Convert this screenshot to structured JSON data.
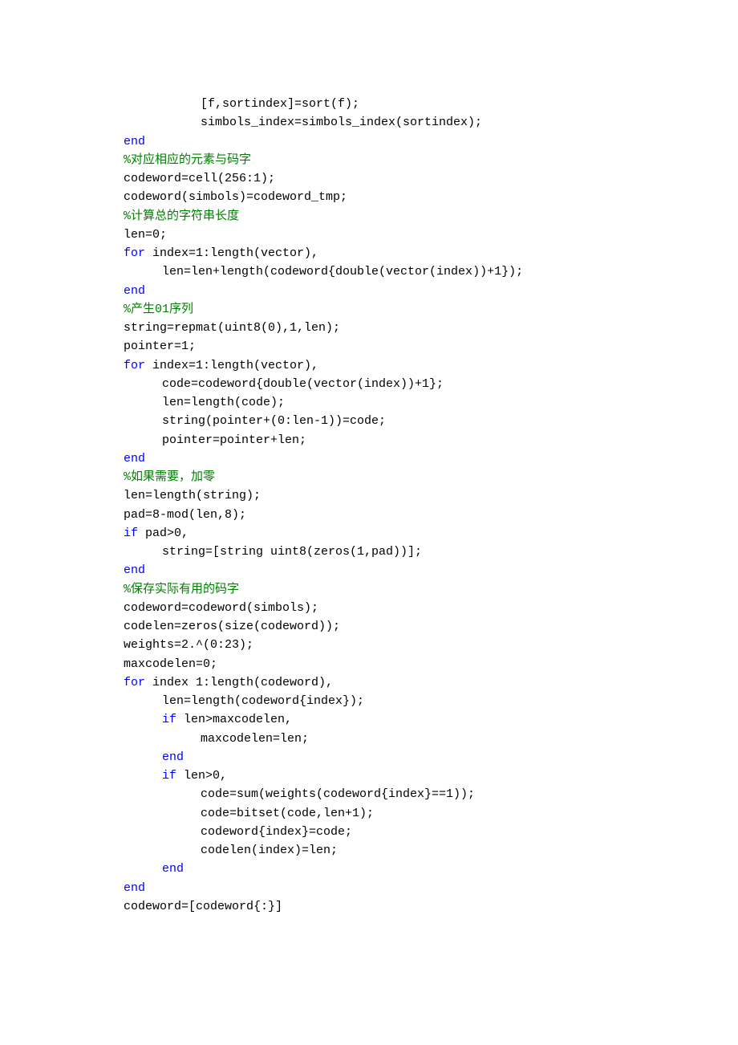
{
  "lines": [
    {
      "ind": 2,
      "txt": "[f,sortindex]=sort(f);"
    },
    {
      "ind": 2,
      "txt": "simbols_index=simbols_index(sortindex);"
    },
    {
      "ind": 0,
      "kw": "end"
    },
    {
      "ind": 0,
      "cm": "%对应相应的元素与码字"
    },
    {
      "ind": 0,
      "txt": "codeword=cell(256:1);"
    },
    {
      "ind": 0,
      "txt": "codeword(simbols)=codeword_tmp;"
    },
    {
      "ind": 0,
      "cm": "%计算总的字符串长度"
    },
    {
      "ind": 0,
      "txt": "len=0;"
    },
    {
      "ind": 0,
      "kw": "for",
      "txt": " index=1:length(vector),"
    },
    {
      "ind": 1,
      "txt": "len=len+length(codeword{double(vector(index))+1});"
    },
    {
      "ind": 0,
      "kw": "end"
    },
    {
      "ind": 0,
      "cm": "%产生01序列"
    },
    {
      "ind": 0,
      "txt": "string=repmat(uint8(0),1,len);"
    },
    {
      "ind": 0,
      "txt": "pointer=1;"
    },
    {
      "ind": 0,
      "kw": "for",
      "txt": " index=1:length(vector),"
    },
    {
      "ind": 1,
      "txt": "code=codeword{double(vector(index))+1};"
    },
    {
      "ind": 1,
      "txt": "len=length(code);"
    },
    {
      "ind": 1,
      "txt": "string(pointer+(0:len-1))=code;"
    },
    {
      "ind": 1,
      "txt": "pointer=pointer+len;"
    },
    {
      "ind": 0,
      "kw": "end"
    },
    {
      "ind": 0,
      "cm": "%如果需要，加零"
    },
    {
      "ind": 0,
      "txt": "len=length(string);"
    },
    {
      "ind": 0,
      "txt": "pad=8-mod(len,8);"
    },
    {
      "ind": 0,
      "kw": "if",
      "txt": " pad>0,"
    },
    {
      "ind": 1,
      "txt": "string=[string uint8(zeros(1,pad))];"
    },
    {
      "ind": 0,
      "kw": "end"
    },
    {
      "ind": 0,
      "cm": "%保存实际有用的码字"
    },
    {
      "ind": 0,
      "txt": "codeword=codeword(simbols);"
    },
    {
      "ind": 0,
      "txt": "codelen=zeros(size(codeword));"
    },
    {
      "ind": 0,
      "txt": "weights=2.^(0:23);"
    },
    {
      "ind": 0,
      "txt": "maxcodelen=0;"
    },
    {
      "ind": 0,
      "kw": "for",
      "txt": " index 1:length(codeword),"
    },
    {
      "ind": 1,
      "txt": "len=length(codeword{index});"
    },
    {
      "ind": 1,
      "kw": "if",
      "txt": " len>maxcodelen,"
    },
    {
      "ind": 2,
      "txt": "maxcodelen=len;"
    },
    {
      "ind": 1,
      "kw": "end"
    },
    {
      "ind": 1,
      "kw": "if",
      "txt": " len>0,"
    },
    {
      "ind": 2,
      "txt": "code=sum(weights(codeword{index}==1));"
    },
    {
      "ind": 2,
      "txt": "code=bitset(code,len+1);"
    },
    {
      "ind": 2,
      "txt": "codeword{index}=code;"
    },
    {
      "ind": 2,
      "txt": "codelen(index)=len;"
    },
    {
      "ind": 1,
      "kw": "end"
    },
    {
      "ind": 0,
      "kw": "end"
    },
    {
      "ind": 0,
      "txt": "codeword=[codeword{:}]"
    }
  ]
}
